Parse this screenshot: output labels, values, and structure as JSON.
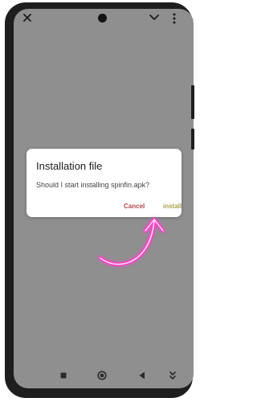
{
  "device": {
    "frame_color": "#1e1e1e",
    "screen_color": "#8f8f8f"
  },
  "status_bar": {
    "icons": [
      "close-icon",
      "camera",
      "chevron-down-icon",
      "more-vertical-icon"
    ]
  },
  "dialog": {
    "title": "Installation file",
    "message": "Should I start installing spinfin.apk?",
    "cancel_label": "Cancel",
    "install_label": "install",
    "cancel_color": "#b5484e",
    "install_color": "#a9a04d"
  },
  "pointer": {
    "icon": "curved-arrow-icon",
    "color": "#ff3fc8"
  },
  "nav_bar": {
    "icons": [
      "square-icon",
      "home-circle-icon",
      "back-triangle-icon",
      "download-icon"
    ]
  }
}
